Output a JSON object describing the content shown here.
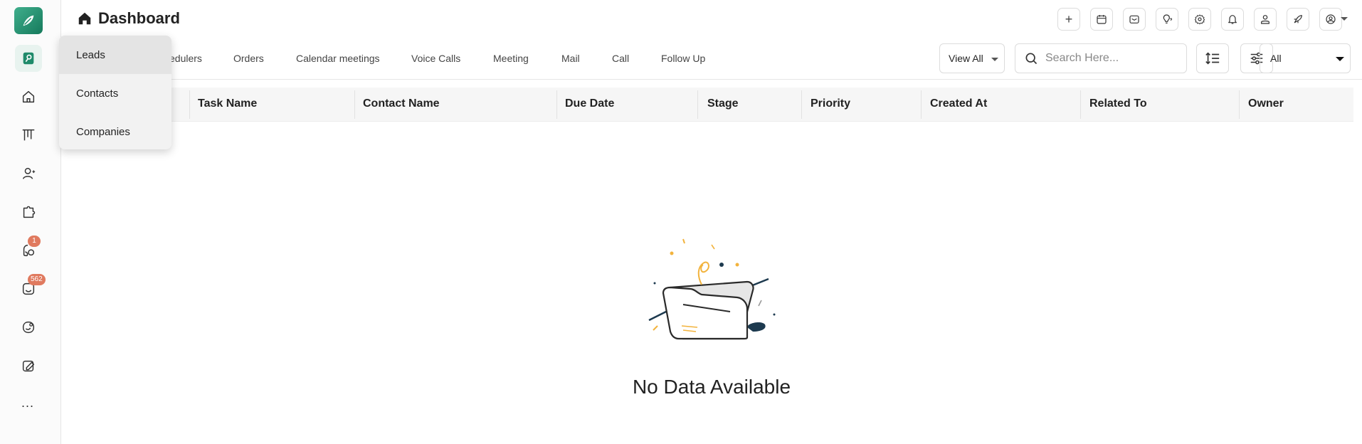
{
  "header": {
    "title": "Dashboard",
    "buttons": [
      {
        "name": "plus-icon"
      },
      {
        "name": "calendar-icon"
      },
      {
        "name": "mail-icon"
      },
      {
        "name": "idea-icon"
      },
      {
        "name": "gear-icon"
      },
      {
        "name": "bell-icon"
      },
      {
        "name": "user-icon"
      },
      {
        "name": "rocket-icon"
      },
      {
        "name": "account-icon"
      }
    ]
  },
  "sidebar": {
    "items": [
      {
        "name": "dashboard-icon"
      },
      {
        "name": "home-icon"
      },
      {
        "name": "kanban-icon"
      },
      {
        "name": "contacts-icon"
      },
      {
        "name": "puzzle-icon"
      },
      {
        "name": "calls-icon",
        "badge": "1"
      },
      {
        "name": "tasks-icon",
        "badge": "562"
      },
      {
        "name": "chat-icon"
      },
      {
        "name": "notes-icon"
      }
    ],
    "more": "..."
  },
  "dropdown": {
    "items": [
      "Leads",
      "Contacts",
      "Companies"
    ]
  },
  "tabs": [
    "edulers",
    "Orders",
    "Calendar meetings",
    "Voice Calls",
    "Meeting",
    "Mail",
    "Call",
    "Follow Up"
  ],
  "toolbar": {
    "view_all": "View All",
    "search_placeholder": "Search Here...",
    "filter_select": "All"
  },
  "table": {
    "columns": [
      "Task Name",
      "Contact Name",
      "Due Date",
      "Stage",
      "Priority",
      "Created At",
      "Related To",
      "Owner"
    ]
  },
  "empty_state": {
    "message": "No Data Available"
  },
  "colors": {
    "brand": "#1f8a6a",
    "badge": "#e07a5f"
  }
}
